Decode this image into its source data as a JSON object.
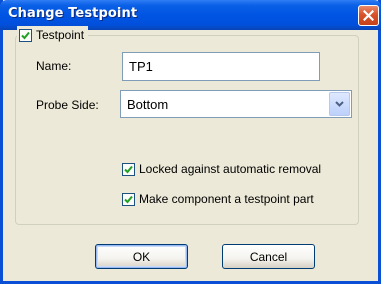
{
  "window": {
    "title": "Change Testpoint"
  },
  "group": {
    "label": "Testpoint",
    "checked": true
  },
  "fields": {
    "name_label": "Name:",
    "name_value": "TP1",
    "probe_side_label": "Probe Side:",
    "probe_side_value": "Bottom"
  },
  "options": {
    "locked_label": "Locked against automatic removal",
    "locked_checked": true,
    "make_component_label": "Make component a testpoint part",
    "make_component_checked": true
  },
  "buttons": {
    "ok": "OK",
    "cancel": "Cancel"
  },
  "colors": {
    "titlebar": "#0054e3",
    "dialog_bg": "#ece9d8",
    "close_button": "#d9522a",
    "check_mark": "#21a121"
  }
}
